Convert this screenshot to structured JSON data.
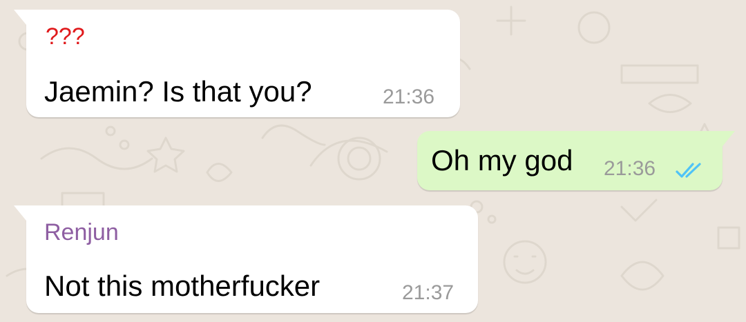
{
  "colors": {
    "wallpaper": "#ece5dd",
    "incoming_bubble": "#ffffff",
    "outgoing_bubble": "#dcf8c6",
    "timestamp": "#9a9a9a",
    "read_receipt": "#4fc3f7"
  },
  "messages": [
    {
      "direction": "incoming",
      "sender": "???",
      "sender_color": "#e0191b",
      "text": "Jaemin? Is that you?",
      "time": "21:36"
    },
    {
      "direction": "outgoing",
      "text": "Oh my god",
      "time": "21:36",
      "status_icon": "double-check-read-icon"
    },
    {
      "direction": "incoming",
      "sender": "Renjun",
      "sender_color": "#8e5ea2",
      "text": "Not this motherfucker",
      "time": "21:37"
    }
  ]
}
